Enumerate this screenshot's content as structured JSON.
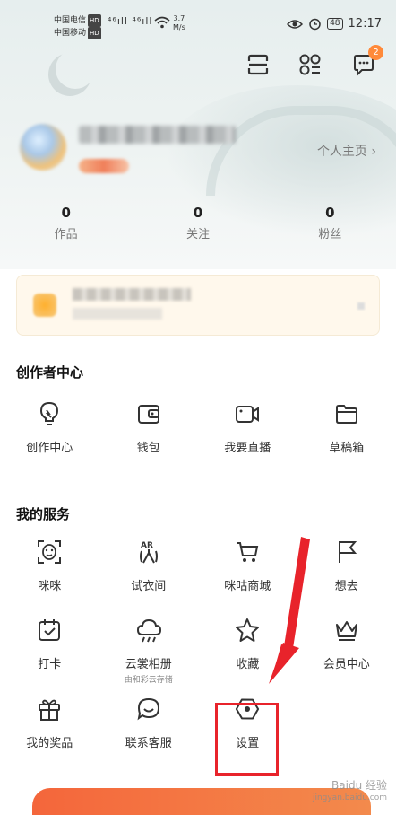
{
  "status_bar": {
    "carrier1": "中国电信",
    "carrier2": "中国移动",
    "hd": "HD",
    "signal": "⁴⁶ıll ⁴⁶ıll",
    "speed_value": "3.7",
    "speed_unit": "M/s",
    "battery": "48",
    "time": "12:17"
  },
  "header": {
    "message_badge": "2",
    "profile_link": "个人主页 ›"
  },
  "stats": [
    {
      "value": "0",
      "label": "作品"
    },
    {
      "value": "0",
      "label": "关注"
    },
    {
      "value": "0",
      "label": "粉丝"
    }
  ],
  "creator_center": {
    "title": "创作者中心",
    "items": [
      {
        "label": "创作中心",
        "icon": "lightbulb-icon"
      },
      {
        "label": "钱包",
        "icon": "wallet-icon"
      },
      {
        "label": "我要直播",
        "icon": "video-camera-icon"
      },
      {
        "label": "草稿箱",
        "icon": "folder-icon"
      }
    ]
  },
  "my_services": {
    "title": "我的服务",
    "items": [
      {
        "label": "咪咪",
        "icon": "face-scan-icon"
      },
      {
        "label": "试衣间",
        "icon": "ar-hanger-icon"
      },
      {
        "label": "咪咕商城",
        "icon": "cart-icon"
      },
      {
        "label": "想去",
        "icon": "flag-icon"
      },
      {
        "label": "打卡",
        "icon": "calendar-check-icon"
      },
      {
        "label": "云裳相册",
        "sub": "由和彩云存储",
        "icon": "cloud-icon"
      },
      {
        "label": "收藏",
        "icon": "star-icon"
      },
      {
        "label": "会员中心",
        "icon": "crown-icon"
      },
      {
        "label": "我的奖品",
        "icon": "gift-icon"
      },
      {
        "label": "联系客服",
        "icon": "chat-smile-icon"
      },
      {
        "label": "设置",
        "icon": "settings-hexagon-icon"
      }
    ]
  },
  "watermark": {
    "brand": "Baidu 经验",
    "url": "jingyan.baidu.com"
  },
  "colors": {
    "highlight_red": "#e8232b",
    "badge_orange": "#ff8a3a",
    "banner_orange": "#f4663b"
  }
}
